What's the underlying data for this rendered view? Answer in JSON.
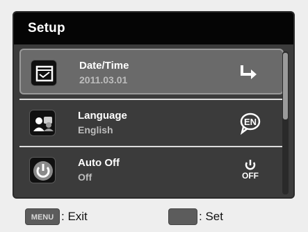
{
  "header": {
    "title": "Setup"
  },
  "menu": {
    "items": [
      {
        "label": "Date/Time",
        "value": "2011.03.01",
        "icon": "calendar-icon",
        "action_icon": "enter-arrow-icon"
      },
      {
        "label": "Language",
        "value": "English",
        "icon": "language-icon",
        "action_icon": "en-speech-icon",
        "action_text": "EN"
      },
      {
        "label": "Auto Off",
        "value": "Off",
        "icon": "power-icon",
        "action_icon": "power-off-icon",
        "action_text": "OFF"
      }
    ]
  },
  "footer": {
    "menu_key": "MENU",
    "exit_label": ": Exit",
    "set_label": ": Set"
  }
}
